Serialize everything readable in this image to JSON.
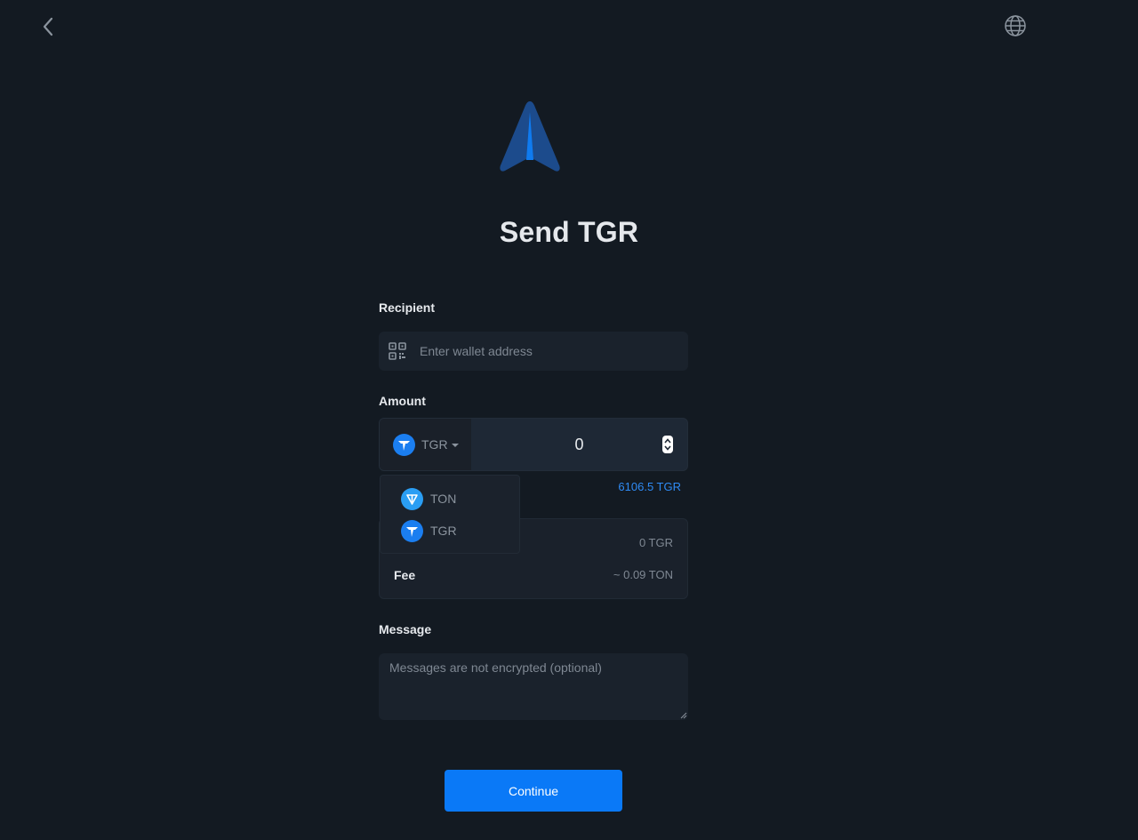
{
  "page": {
    "title": "Send TGR"
  },
  "recipient": {
    "label": "Recipient",
    "placeholder": "Enter wallet address"
  },
  "amount": {
    "label": "Amount",
    "selected_token": "TGR",
    "value": "0",
    "balance": "6106.5 TGR"
  },
  "token_dropdown": {
    "options": [
      {
        "label": "TON",
        "icon": "ton-icon",
        "color": "#2a9ef4"
      },
      {
        "label": "TGR",
        "icon": "tgr-icon",
        "color": "#1b7ef0"
      }
    ]
  },
  "summary": {
    "total_value": "0 TGR",
    "fee_label": "Fee",
    "fee_value": "~ 0.09 TON"
  },
  "message": {
    "label": "Message",
    "placeholder": "Messages are not encrypted (optional)"
  },
  "actions": {
    "continue_label": "Continue"
  },
  "colors": {
    "accent": "#0a79f7",
    "background": "#131a22",
    "link": "#2f8bf5"
  }
}
